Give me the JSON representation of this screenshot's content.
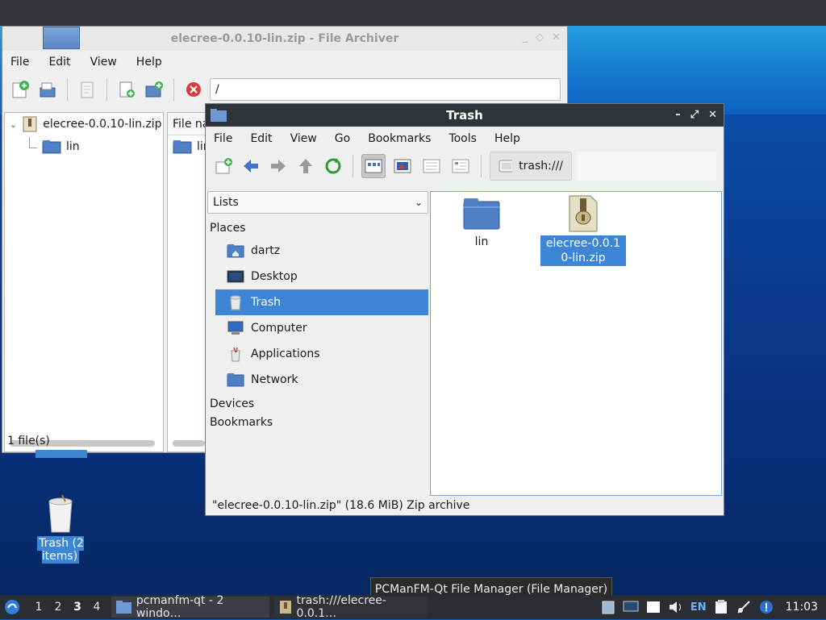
{
  "archiver": {
    "title": "elecree-0.0.10-lin.zip - File Archiver",
    "menu": [
      "File",
      "Edit",
      "View",
      "Help"
    ],
    "path_value": "/",
    "tree": [
      "elecree-0.0.10-lin.zip",
      "lin"
    ],
    "list_header": "File na",
    "list_items": [
      "lin"
    ],
    "status": "1 file(s)"
  },
  "trash": {
    "title": "Trash",
    "menu": [
      "File",
      "Edit",
      "View",
      "Go",
      "Bookmarks",
      "Tools",
      "Help"
    ],
    "address": "trash:///",
    "side_combo": "Lists",
    "places_header": "Places",
    "places": [
      "dartz",
      "Desktop",
      "Trash",
      "Computer",
      "Applications",
      "Network"
    ],
    "selected_place": "Trash",
    "devices_header": "Devices",
    "bookmarks_header": "Bookmarks",
    "files": [
      {
        "name": "lin",
        "icon": "folder-icon"
      },
      {
        "name": "elecree-0.0.10-lin.zip",
        "icon": "zip-icon"
      }
    ],
    "status": "\"elecree-0.0.10-lin.zip\" (18.6 MiB) Zip archive"
  },
  "desktop": {
    "trash_label": "Trash (2 items)"
  },
  "tooltip": "PCManFM-Qt File Manager (File Manager)",
  "taskbar": {
    "desktops": [
      "1",
      "2",
      "3",
      "4"
    ],
    "current_desktop": "3",
    "tasks": [
      "pcmanfm-qt - 2 windo…",
      "trash:///elecree-0.0.1…"
    ],
    "lang": "EN",
    "clock": "11:03"
  },
  "colors": {
    "selection": "#3d86d6",
    "panel": "#2a2d31"
  }
}
